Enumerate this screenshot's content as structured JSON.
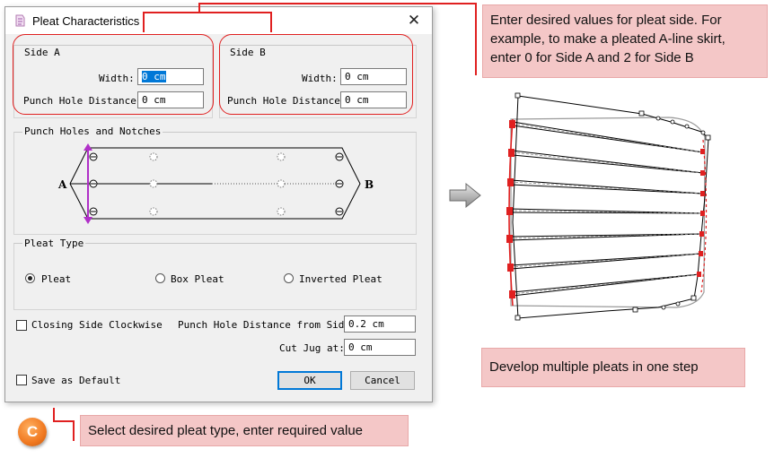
{
  "dialog": {
    "title": "Pleat Characteristics",
    "close_symbol": "✕",
    "side_a": {
      "label": "Side A",
      "width_label": "Width:",
      "width_value": "0 cm",
      "punch_label": "Punch Hole Distance:",
      "punch_value": "0 cm"
    },
    "side_b": {
      "label": "Side B",
      "width_label": "Width:",
      "width_value": "0 cm",
      "punch_label": "Punch Hole Distance:",
      "punch_value": "0 cm"
    },
    "punch_group": {
      "label": "Punch Holes and Notches",
      "letter_a": "A",
      "letter_b": "B"
    },
    "pleat_type": {
      "label": "Pleat Type",
      "options": [
        "Pleat",
        "Box Pleat",
        "Inverted Pleat"
      ],
      "selected": "Pleat"
    },
    "closing_side_label": "Closing Side Clockwise",
    "punch_from_side_label": "Punch Hole Distance from Side:",
    "punch_from_side_value": "0.2 cm",
    "cut_jug_label": "Cut Jug at:",
    "cut_jug_value": "0 cm",
    "save_default_label": "Save as Default",
    "ok_label": "OK",
    "cancel_label": "Cancel"
  },
  "callouts": {
    "top_right": "Enter desired values for pleat side.  For example, to make a pleated A-line skirt, enter 0 for Side A and 2 for Side B",
    "bottom_right": "Develop multiple pleats in one step",
    "bottom_left": "Select desired pleat type, enter required value",
    "badge_letter": "C"
  },
  "colors": {
    "callout_bg": "#f4c7c7",
    "callout_line": "#e02020",
    "accent_purple": "#b030c8",
    "badge_orange": "#f07820",
    "select_blue": "#0078d7"
  }
}
